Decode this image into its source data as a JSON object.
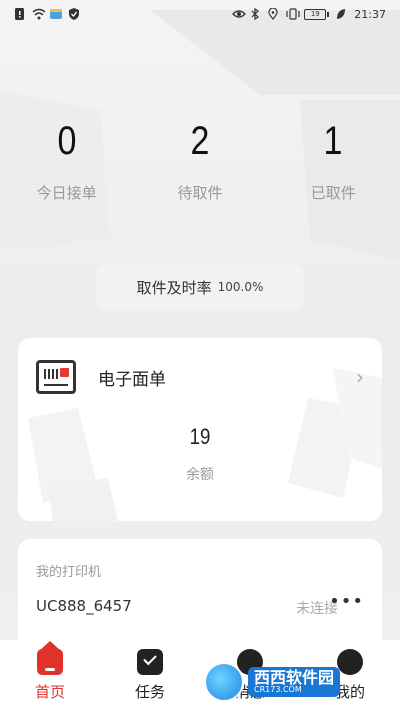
{
  "statusbar": {
    "time": "21:37",
    "battery": "19",
    "left_icons": [
      "sim-icon",
      "wifi-icon",
      "app-icon",
      "shield-icon"
    ],
    "right_icons": [
      "eye-icon",
      "bluetooth-icon",
      "location-icon",
      "vibrate-icon",
      "battery-icon",
      "leaf-icon"
    ]
  },
  "stats": [
    {
      "value": "0",
      "label": "今日接单"
    },
    {
      "value": "2",
      "label": "待取件"
    },
    {
      "value": "1",
      "label": "已取件"
    }
  ],
  "rate": {
    "label": "取件及时率",
    "value": "100.0%"
  },
  "waybill": {
    "title": "电子面单",
    "balance": "19",
    "balance_label": "余额"
  },
  "printer": {
    "title": "我的打印机",
    "name": "UC888_6457",
    "status": "未连接",
    "more": "•••"
  },
  "tabs": [
    {
      "label": "首页",
      "icon": "home-icon",
      "active": true
    },
    {
      "label": "任务",
      "icon": "task-icon",
      "active": false
    },
    {
      "label": "消息",
      "icon": "message-icon",
      "active": false
    },
    {
      "label": "我的",
      "icon": "profile-icon",
      "active": false
    }
  ],
  "watermark": {
    "main": "西西软件园",
    "sub": "CR173.COM"
  },
  "colors": {
    "accent": "#e0312b",
    "background": "#eeeeee",
    "card": "#ffffff"
  }
}
